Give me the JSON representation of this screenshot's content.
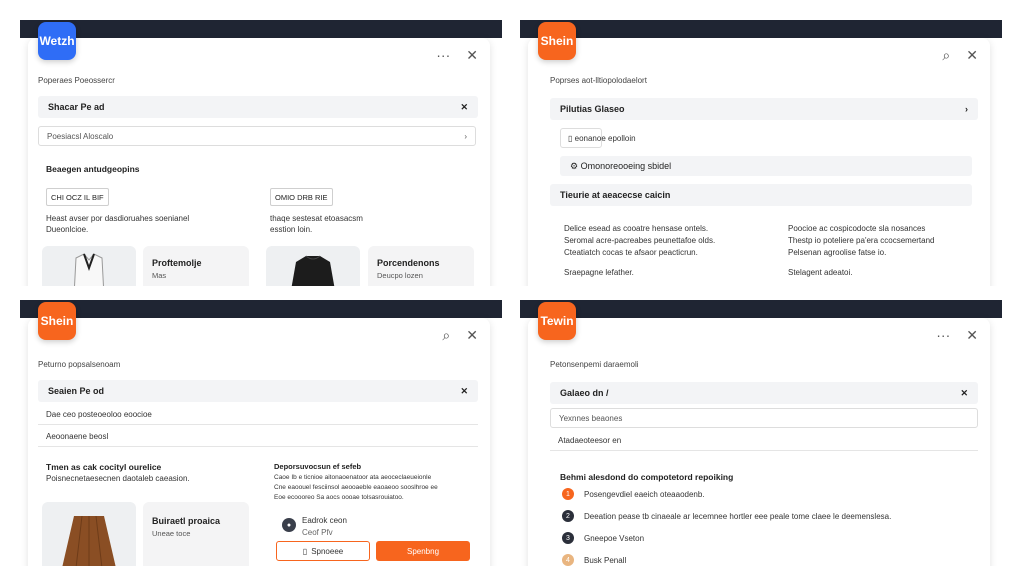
{
  "q1": {
    "logo": "Wetzh",
    "icons": [
      "more-icon",
      "close-icon"
    ],
    "breadcrumb": "Poperaes Poeossercr",
    "search_row": "Shacar Pe ad",
    "field_value": "Poesiacsl Aloscalo",
    "section_title": "Beaegen antudgeopins",
    "tag1": "CHI OCZ IL BIF",
    "desc1": "Heast avser por dasdioruahes soenianel",
    "desc1b": "Dueonlcioe.",
    "tag2": "OMIO DRB RIE",
    "desc2": "thaqe sestesat etoasacsm",
    "desc2b": "esstion loin.",
    "card1_title": "Proftemolje",
    "card1_sub": "Mas",
    "card2_title": "Porcendenons",
    "card2_sub": "Deucpo lozen"
  },
  "q2": {
    "logo": "Shein",
    "icons": [
      "search-icon",
      "close-icon"
    ],
    "breadcrumb": "Poprses aot-lltiopolodaelort",
    "row1": "Pilutias Glaseo",
    "item1": "eonanoe epolloin",
    "item2": "Omonoreooeing sbidel",
    "row2": "Tieurie at aeacecse caicin",
    "col1_p1": "Delice esead as cooatre hensase ontels.",
    "col1_p2": "Seromal acre-pacreabes peunettafoe olds.",
    "col1_p3": "Cteatiatch cocas te afsaor peacticrun.",
    "col1_p4": "Sraepagne lefather.",
    "col2_p1": "Poocioe ac cospicodocte sla nosances",
    "col2_p2": "Thestp io poteliere pa'era ccocsemertand",
    "col2_p3": "Pelsenan agroolise fatse io.",
    "col2_p4": "Stelagent adeatoi."
  },
  "q3": {
    "logo": "Shein",
    "icons": [
      "search-icon",
      "close-icon"
    ],
    "breadcrumb": "Peturno popsalsenoam",
    "search_row": "Seaien Pe od",
    "line1": "Dae ceo posteoeoloo eoocioe",
    "line2": "Aeoonaene beosl",
    "left_title": "Tmen as cak cocityl ourelice",
    "left_sub": "Poisnecnetaesecnen daotaleb caeasion.",
    "card_title": "Buiraetl proaica",
    "card_sub": "Uneae toce",
    "right_title": "Deporsuvocsun ef sefeb",
    "right_p1": "Caoe Ib e ticnioe aitonaoenatoor ata aeoceclaeueionle",
    "right_p2": "Cne eaoouel fesciinsol aeooaeble eaoaeoo sooslhroe ee",
    "right_p3": "Eoe ecoooreo Sa aocs oooae tolsasrouiatoo.",
    "user_name": "Eadrok ceon",
    "user_sub": "Ceof Pfv",
    "btn_outline": "Spnoeee",
    "btn_fill": "Spenbng"
  },
  "q4": {
    "logo": "Tewin",
    "icons": [
      "more-icon",
      "close-icon"
    ],
    "breadcrumb": "Petonsenpemi daraemoli",
    "search_row": "Galaeo dn  /",
    "field_value": "Yexnnes beaones",
    "line1": "Atadaeoteesor en",
    "steps_title": "Behmi alesdond do compotetord repoiking",
    "steps": [
      {
        "num": "1",
        "text": "Posengevdiel eaeich oteaaodenb."
      },
      {
        "num": "2",
        "text": "Deeation pease tb cinaeale ar lecemnee hortler eee peale tome claee le deemenslesa."
      },
      {
        "num": "3",
        "text": "Gneepoe Vseton"
      },
      {
        "num": "4",
        "text": "Busk Penall"
      }
    ],
    "colors": {
      "orange": "#f7651e",
      "dark": "#2b2f3a",
      "tan": "#e9b580"
    }
  }
}
